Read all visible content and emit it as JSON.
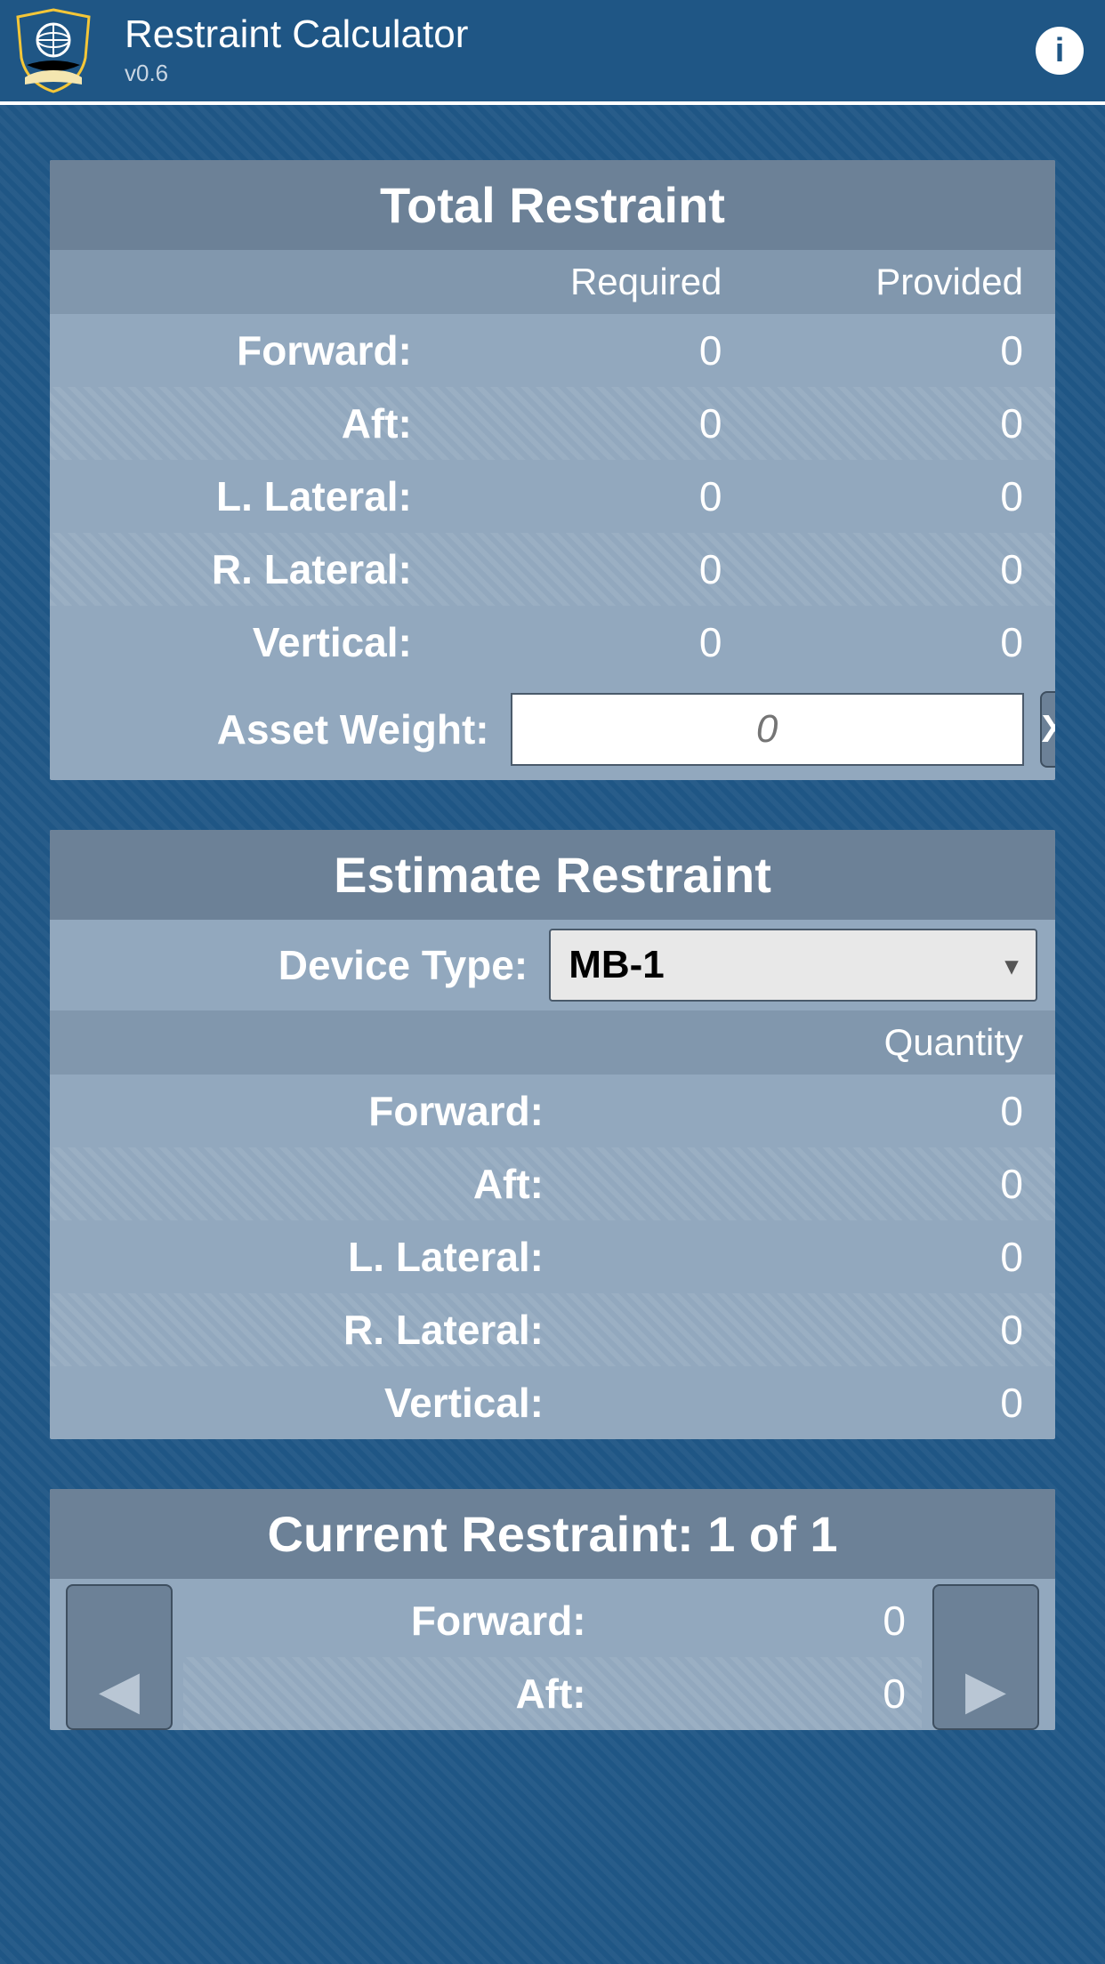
{
  "header": {
    "title": "Restraint Calculator",
    "version": "v0.6"
  },
  "total": {
    "title": "Total Restraint",
    "col_required": "Required",
    "col_provided": "Provided",
    "rows": [
      {
        "label": "Forward:",
        "required": "0",
        "provided": "0"
      },
      {
        "label": "Aft:",
        "required": "0",
        "provided": "0"
      },
      {
        "label": "L. Lateral:",
        "required": "0",
        "provided": "0"
      },
      {
        "label": "R. Lateral:",
        "required": "0",
        "provided": "0"
      },
      {
        "label": "Vertical:",
        "required": "0",
        "provided": "0"
      }
    ],
    "asset_weight_label": "Asset Weight:",
    "asset_weight_placeholder": "0",
    "clear_label": "X"
  },
  "estimate": {
    "title": "Estimate Restraint",
    "device_type_label": "Device Type:",
    "device_type_value": "MB-1",
    "quantity_label": "Quantity",
    "rows": [
      {
        "label": "Forward:",
        "value": "0"
      },
      {
        "label": "Aft:",
        "value": "0"
      },
      {
        "label": "L. Lateral:",
        "value": "0"
      },
      {
        "label": "R. Lateral:",
        "value": "0"
      },
      {
        "label": "Vertical:",
        "value": "0"
      }
    ]
  },
  "current": {
    "title": "Current Restraint: 1 of 1",
    "rows": [
      {
        "label": "Forward:",
        "value": "0"
      },
      {
        "label": "Aft:",
        "value": "0"
      }
    ]
  }
}
